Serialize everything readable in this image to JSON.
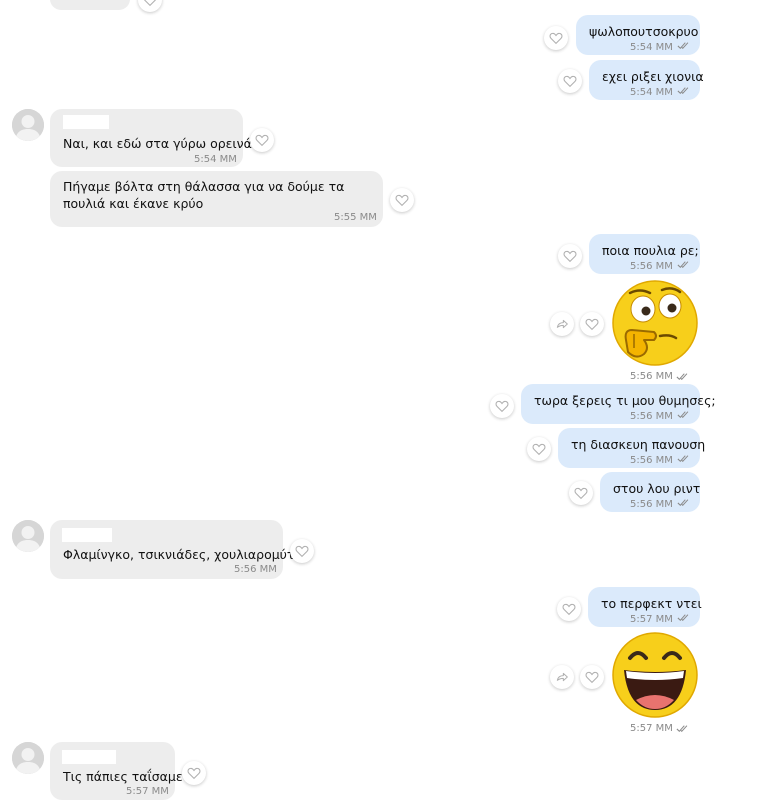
{
  "colors": {
    "outgoing_bubble": "#dbeafb",
    "incoming_bubble": "#ededed",
    "meta_text": "#8a8a8a",
    "sticker_yellow": "#f7cf1b"
  },
  "messages": [
    {
      "direction": "out",
      "text": "ψωλοπουτσοκρυο",
      "time": "5:54 MM",
      "status": "read-double-check"
    },
    {
      "direction": "out",
      "text": "εχει ριξει χιονια",
      "time": "5:54 MM",
      "status": "read-double-check"
    },
    {
      "direction": "in",
      "text": "Ναι, και εδώ στα γύρω ορεινά",
      "time": "5:54 MM"
    },
    {
      "direction": "in",
      "text": "Πήγαμε βόλτα στη θάλασσα για να δούμε τα πουλιά και έκανε κρύο",
      "time": "5:55 MM"
    },
    {
      "direction": "out",
      "text": "ποια πουλια ρε;",
      "time": "5:56 MM",
      "status": "read-double-check"
    },
    {
      "direction": "out",
      "sticker": "thinking-emoji-sticker",
      "time": "5:56 MM",
      "status": "read-double-check"
    },
    {
      "direction": "out",
      "text": "τωρα ξερεις τι μου θυμησες;",
      "time": "5:56 MM",
      "status": "read-double-check"
    },
    {
      "direction": "out",
      "text": "τη διασκευη πανουση",
      "time": "5:56 MM",
      "status": "read-double-check"
    },
    {
      "direction": "out",
      "text": "στου λου ριντ",
      "time": "5:56 MM",
      "status": "read-double-check"
    },
    {
      "direction": "in",
      "text": "Φλαμίνγκο, τσικνιάδες, χουλιαρομύτες",
      "time": "5:56 MM"
    },
    {
      "direction": "out",
      "text": "το περφεκτ ντει",
      "time": "5:57 MM",
      "status": "read-double-check"
    },
    {
      "direction": "out",
      "sticker": "laughing-emoji-sticker",
      "time": "5:57 MM",
      "status": "read-double-check"
    },
    {
      "direction": "in",
      "text": "Τις πάπιες ταΐσαμε",
      "time": "5:57 MM"
    }
  ],
  "icons": {
    "like": "heart-icon",
    "forward": "share-icon",
    "read": "double-check-icon",
    "avatar": "user-silhouette-icon"
  }
}
